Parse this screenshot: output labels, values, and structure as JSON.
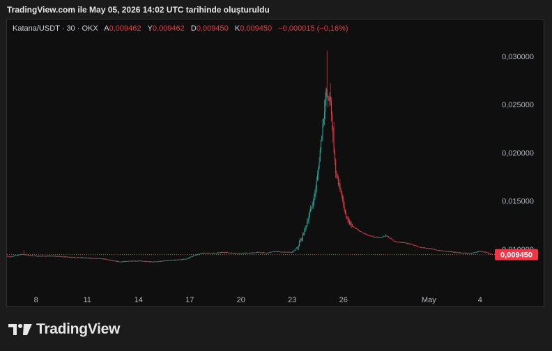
{
  "header": {
    "snapshot_text": "TradingView.com ile May 05, 2026 14:02 UTC tarihinde oluşturuldu"
  },
  "legend": {
    "symbol": "Katana/USDT · 30 · OKX",
    "open_label": "A",
    "open_value": "0,009462",
    "high_label": "Y",
    "high_value": "0,009462",
    "low_label": "D",
    "low_value": "0,009450",
    "close_label": "K",
    "close_value": "0,009450",
    "change": "−0,000015 (−0,16%)"
  },
  "brand": {
    "name": "TradingView"
  },
  "colors": {
    "up": "#26a69a",
    "down": "#f23645",
    "background": "#0f0f0f",
    "grid": "#1f1f1f",
    "price_line": "#f23645"
  },
  "chart_data": {
    "type": "candlestick",
    "title": "Katana/USDT · 30 · OKX",
    "y_ticks": [
      "0,030000",
      "0,025000",
      "0,020000",
      "0,015000",
      "0,010000"
    ],
    "y_tick_values": [
      0.03,
      0.025,
      0.02,
      0.015,
      0.01
    ],
    "ylim": [
      0.0061,
      0.0315
    ],
    "x_ticks": [
      "8",
      "11",
      "14",
      "17",
      "20",
      "23",
      "26",
      "May",
      "4"
    ],
    "x_tick_days": [
      8,
      11,
      14,
      17,
      20,
      23,
      26,
      31,
      34
    ],
    "xlim_days": [
      6.3,
      34.7
    ],
    "current_price": "0,009450",
    "current_price_value": 0.00945,
    "grid": false,
    "series": [
      {
        "price_path": [
          [
            6.3,
            0.0093
          ],
          [
            6.5,
            0.0092
          ],
          [
            6.9,
            0.0094
          ],
          [
            7.2,
            0.0095
          ],
          [
            7.5,
            0.0094
          ],
          [
            8.0,
            0.0093
          ],
          [
            9.0,
            0.0093
          ],
          [
            10.0,
            0.0092
          ],
          [
            11.0,
            0.0091
          ],
          [
            12.0,
            0.009
          ],
          [
            12.5,
            0.0088
          ],
          [
            13.0,
            0.0087
          ],
          [
            13.5,
            0.0088
          ],
          [
            14.0,
            0.0088
          ],
          [
            14.8,
            0.0087
          ],
          [
            15.5,
            0.0088
          ],
          [
            16.2,
            0.0089
          ],
          [
            16.8,
            0.009
          ],
          [
            17.3,
            0.0094
          ],
          [
            17.8,
            0.0096
          ],
          [
            18.5,
            0.0096
          ],
          [
            19.0,
            0.0097
          ],
          [
            19.5,
            0.0096
          ],
          [
            20.0,
            0.0096
          ],
          [
            20.5,
            0.0096
          ],
          [
            21.0,
            0.0097
          ],
          [
            21.5,
            0.0096
          ],
          [
            22.0,
            0.0098
          ],
          [
            22.5,
            0.0097
          ],
          [
            23.0,
            0.0097
          ],
          [
            23.3,
            0.0102
          ],
          [
            23.6,
            0.0113
          ],
          [
            23.9,
            0.013
          ],
          [
            24.1,
            0.0142
          ],
          [
            24.3,
            0.0155
          ],
          [
            24.5,
            0.0178
          ],
          [
            24.7,
            0.0215
          ],
          [
            24.85,
            0.024
          ],
          [
            25.0,
            0.0265
          ],
          [
            25.1,
            0.025
          ],
          [
            25.2,
            0.0262
          ],
          [
            25.3,
            0.0235
          ],
          [
            25.4,
            0.021
          ],
          [
            25.55,
            0.018
          ],
          [
            25.7,
            0.017
          ],
          [
            25.85,
            0.016
          ],
          [
            26.0,
            0.0145
          ],
          [
            26.2,
            0.013
          ],
          [
            26.5,
            0.0124
          ],
          [
            27.0,
            0.0118
          ],
          [
            27.5,
            0.0114
          ],
          [
            28.0,
            0.0112
          ],
          [
            28.5,
            0.0114
          ],
          [
            29.0,
            0.0108
          ],
          [
            29.5,
            0.0107
          ],
          [
            30.0,
            0.0105
          ],
          [
            30.5,
            0.0102
          ],
          [
            31.0,
            0.0101
          ],
          [
            31.5,
            0.0099
          ],
          [
            32.0,
            0.0098
          ],
          [
            32.5,
            0.0097
          ],
          [
            33.0,
            0.0096
          ],
          [
            33.5,
            0.0096
          ],
          [
            34.0,
            0.0098
          ],
          [
            34.3,
            0.0097
          ],
          [
            34.7,
            0.00945
          ]
        ],
        "notable_highs": [
          [
            7.3,
            0.0099
          ],
          [
            24.3,
            0.0158
          ],
          [
            24.6,
            0.0195
          ],
          [
            24.9,
            0.0255
          ],
          [
            25.05,
            0.0306
          ],
          [
            25.25,
            0.0272
          ],
          [
            25.45,
            0.0232
          ],
          [
            26.0,
            0.0155
          ],
          [
            28.5,
            0.0116
          ]
        ]
      }
    ]
  }
}
